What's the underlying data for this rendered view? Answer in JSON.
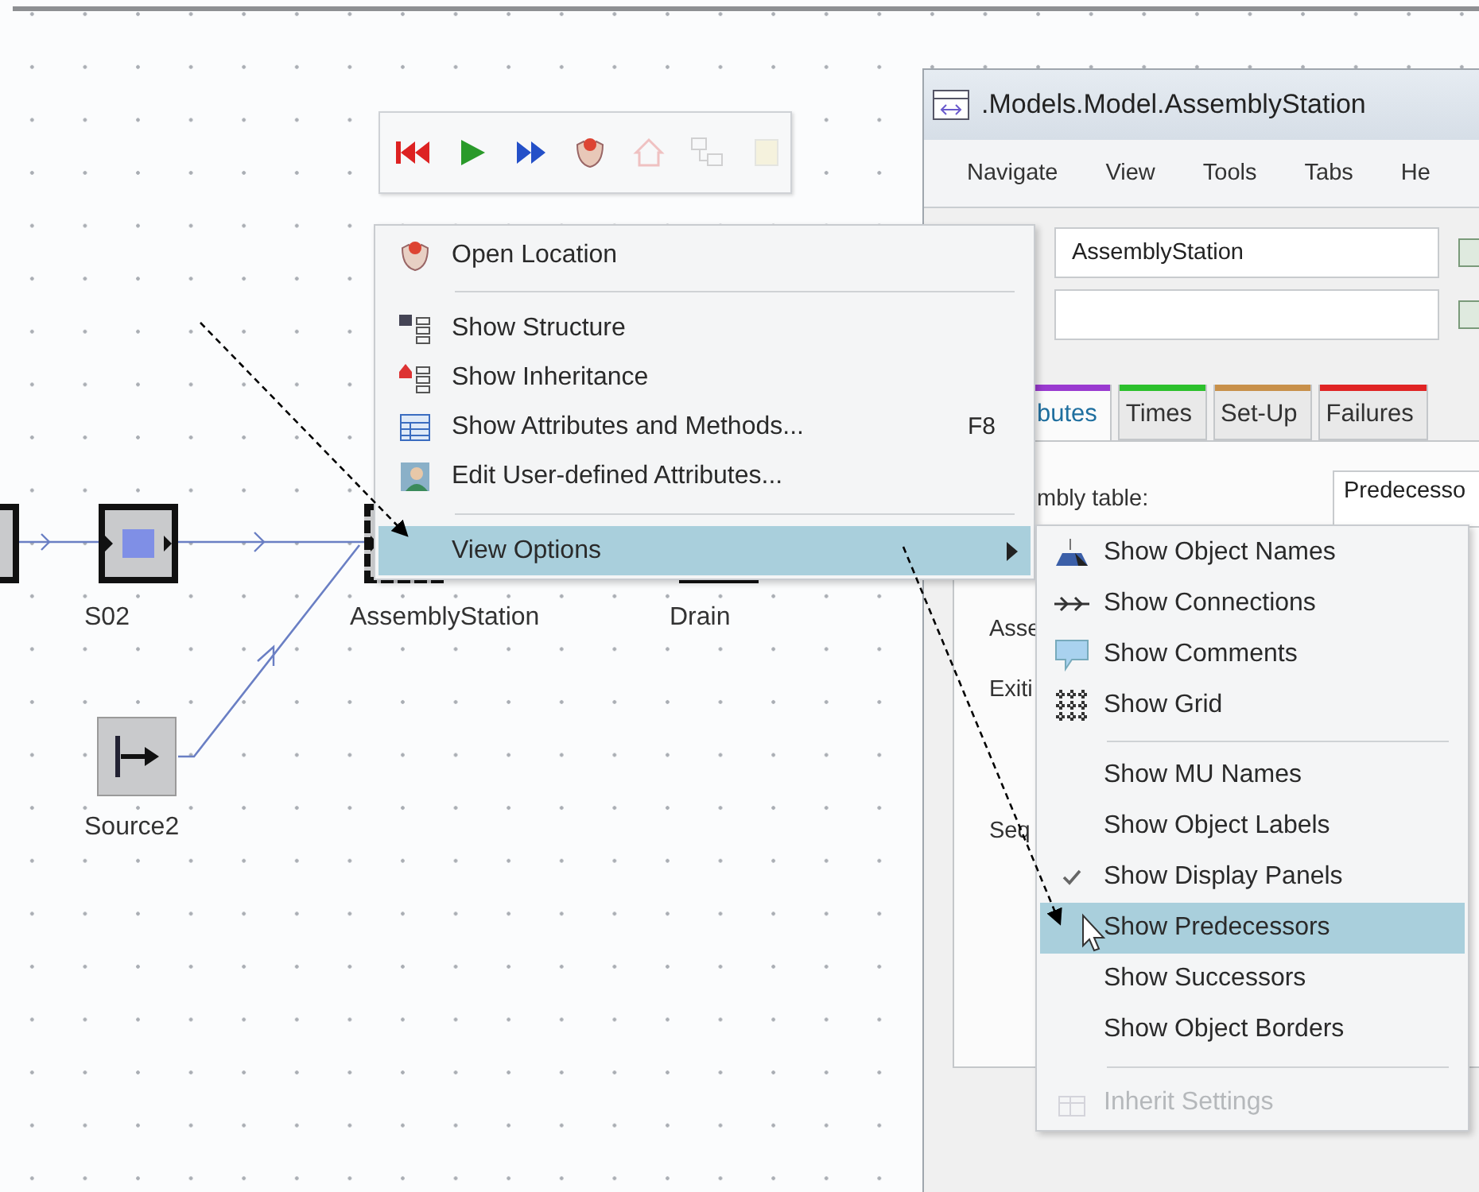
{
  "toolbar": {
    "buttons": [
      {
        "kind": "reset",
        "disabled": false
      },
      {
        "kind": "start",
        "disabled": false
      },
      {
        "kind": "step",
        "disabled": false
      },
      {
        "kind": "location",
        "disabled": false
      },
      {
        "kind": "home",
        "disabled": true
      },
      {
        "kind": "structure",
        "disabled": true
      },
      {
        "kind": "note",
        "disabled": true
      }
    ]
  },
  "canvas": {
    "nodes": [
      {
        "kind": "cut_station"
      },
      {
        "kind": "station",
        "label": "S02"
      },
      {
        "kind": "assembly",
        "label": "AssemblyStation"
      },
      {
        "kind": "drain",
        "label": "Drain"
      },
      {
        "kind": "source",
        "label": "Source2"
      }
    ]
  },
  "window": {
    "title": ".Models.Model.AssemblyStation",
    "menu": [
      "Navigate",
      "View",
      "Tools",
      "Tabs",
      "He"
    ],
    "fields": [
      {
        "value": "AssemblyStation",
        "checked": false
      },
      {
        "checked": false
      }
    ],
    "tabs": [
      {
        "label": "butes",
        "color": "#9a3ad0",
        "selected": true
      },
      {
        "label": "Times",
        "color": "#2cc02c",
        "selected": false
      },
      {
        "label": "Set-Up",
        "color": "#c8904a",
        "selected": false
      },
      {
        "label": "Failures",
        "color": "#e02424",
        "selected": false
      }
    ],
    "form": {
      "labels": [
        "mbly table:",
        "Asse",
        "Exiti",
        "Seq"
      ],
      "field": "Predecesso"
    }
  },
  "context_menu": {
    "items": [
      {
        "kind": "item",
        "label": "Open Location",
        "selected": false
      },
      {
        "kind": "separator"
      },
      {
        "kind": "item",
        "label": "Show Structure",
        "selected": false
      },
      {
        "kind": "item",
        "label": "Show Inheritance",
        "selected": false
      },
      {
        "kind": "item",
        "label": "Show Attributes and Methods...",
        "shortcut": "F8",
        "selected": false
      },
      {
        "kind": "item",
        "label": "Edit User-defined Attributes...",
        "selected": false
      },
      {
        "kind": "separator"
      },
      {
        "kind": "submenu",
        "label": "View Options",
        "selected": true
      }
    ]
  },
  "view_options_menu": {
    "items": [
      {
        "kind": "item",
        "label": "Show Object Names",
        "checked": false,
        "selected": false,
        "disabled": false
      },
      {
        "kind": "item",
        "label": "Show Connections",
        "checked": false,
        "selected": false,
        "disabled": false
      },
      {
        "kind": "item",
        "label": "Show Comments",
        "checked": false,
        "selected": false,
        "disabled": false
      },
      {
        "kind": "item",
        "label": "Show Grid",
        "checked": false,
        "selected": false,
        "disabled": false
      },
      {
        "kind": "separator"
      },
      {
        "kind": "item",
        "label": "Show MU Names",
        "checked": false,
        "selected": false,
        "disabled": false
      },
      {
        "kind": "item",
        "label": "Show Object Labels",
        "checked": false,
        "selected": false,
        "disabled": false
      },
      {
        "kind": "item",
        "label": "Show Display Panels",
        "checked": true,
        "selected": false,
        "disabled": false
      },
      {
        "kind": "item",
        "label": "Show Predecessors",
        "checked": false,
        "selected": true,
        "disabled": false
      },
      {
        "kind": "item",
        "label": "Show Successors",
        "checked": false,
        "selected": false,
        "disabled": false
      },
      {
        "kind": "item",
        "label": "Show Object Borders",
        "checked": false,
        "selected": false,
        "disabled": false
      },
      {
        "kind": "separator"
      },
      {
        "kind": "item",
        "label": "Inherit Settings",
        "checked": false,
        "selected": false,
        "disabled": true
      }
    ]
  }
}
